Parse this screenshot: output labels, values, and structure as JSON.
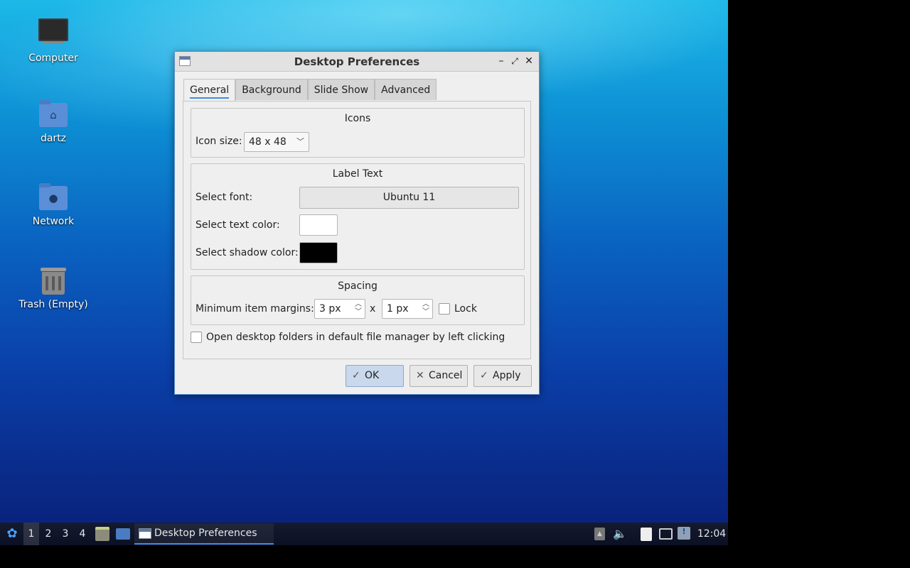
{
  "desktop": {
    "icons": [
      {
        "label": "Computer",
        "icon": "computer-icon"
      },
      {
        "label": "dartz",
        "icon": "home-folder-icon"
      },
      {
        "label": "Network",
        "icon": "network-folder-icon"
      },
      {
        "label": "Trash (Empty)",
        "icon": "trash-icon"
      }
    ]
  },
  "window": {
    "title": "Desktop Preferences",
    "tabs": [
      "General",
      "Background",
      "Slide Show",
      "Advanced"
    ],
    "active_tab": "General",
    "icons_group": {
      "title": "Icons",
      "icon_size_label": "Icon size:",
      "icon_size_value": "48 x 48"
    },
    "label_text_group": {
      "title": "Label Text",
      "font_label": "Select font:",
      "font_value": "Ubuntu 11",
      "text_color_label": "Select text color:",
      "text_color": "#ffffff",
      "shadow_color_label": "Select shadow color:",
      "shadow_color": "#000000"
    },
    "spacing_group": {
      "title": "Spacing",
      "margins_label": "Minimum item margins:",
      "margin_x": "3 px",
      "separator": "x",
      "margin_y": "1 px",
      "lock_label": "Lock",
      "lock_checked": false
    },
    "open_folders_label": "Open desktop folders in default file manager by left clicking",
    "open_folders_checked": false,
    "buttons": {
      "ok": "OK",
      "cancel": "Cancel",
      "apply": "Apply"
    }
  },
  "taskbar": {
    "workspaces": [
      "1",
      "2",
      "3",
      "4"
    ],
    "active_workspace": "1",
    "task_label": "Desktop Preferences",
    "clock": "12:04"
  },
  "colors": {
    "accent": "#3d8ee0",
    "taskbar": "#0f1428"
  }
}
